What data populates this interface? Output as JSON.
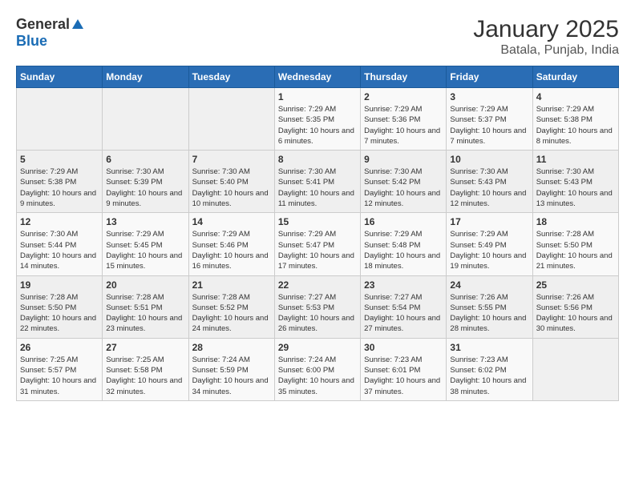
{
  "header": {
    "logo_general": "General",
    "logo_blue": "Blue",
    "title": "January 2025",
    "subtitle": "Batala, Punjab, India"
  },
  "calendar": {
    "weekdays": [
      "Sunday",
      "Monday",
      "Tuesday",
      "Wednesday",
      "Thursday",
      "Friday",
      "Saturday"
    ],
    "weeks": [
      [
        {
          "day": "",
          "sunrise": "",
          "sunset": "",
          "daylight": ""
        },
        {
          "day": "",
          "sunrise": "",
          "sunset": "",
          "daylight": ""
        },
        {
          "day": "",
          "sunrise": "",
          "sunset": "",
          "daylight": ""
        },
        {
          "day": "1",
          "sunrise": "Sunrise: 7:29 AM",
          "sunset": "Sunset: 5:35 PM",
          "daylight": "Daylight: 10 hours and 6 minutes."
        },
        {
          "day": "2",
          "sunrise": "Sunrise: 7:29 AM",
          "sunset": "Sunset: 5:36 PM",
          "daylight": "Daylight: 10 hours and 7 minutes."
        },
        {
          "day": "3",
          "sunrise": "Sunrise: 7:29 AM",
          "sunset": "Sunset: 5:37 PM",
          "daylight": "Daylight: 10 hours and 7 minutes."
        },
        {
          "day": "4",
          "sunrise": "Sunrise: 7:29 AM",
          "sunset": "Sunset: 5:38 PM",
          "daylight": "Daylight: 10 hours and 8 minutes."
        }
      ],
      [
        {
          "day": "5",
          "sunrise": "Sunrise: 7:29 AM",
          "sunset": "Sunset: 5:38 PM",
          "daylight": "Daylight: 10 hours and 9 minutes."
        },
        {
          "day": "6",
          "sunrise": "Sunrise: 7:30 AM",
          "sunset": "Sunset: 5:39 PM",
          "daylight": "Daylight: 10 hours and 9 minutes."
        },
        {
          "day": "7",
          "sunrise": "Sunrise: 7:30 AM",
          "sunset": "Sunset: 5:40 PM",
          "daylight": "Daylight: 10 hours and 10 minutes."
        },
        {
          "day": "8",
          "sunrise": "Sunrise: 7:30 AM",
          "sunset": "Sunset: 5:41 PM",
          "daylight": "Daylight: 10 hours and 11 minutes."
        },
        {
          "day": "9",
          "sunrise": "Sunrise: 7:30 AM",
          "sunset": "Sunset: 5:42 PM",
          "daylight": "Daylight: 10 hours and 12 minutes."
        },
        {
          "day": "10",
          "sunrise": "Sunrise: 7:30 AM",
          "sunset": "Sunset: 5:43 PM",
          "daylight": "Daylight: 10 hours and 12 minutes."
        },
        {
          "day": "11",
          "sunrise": "Sunrise: 7:30 AM",
          "sunset": "Sunset: 5:43 PM",
          "daylight": "Daylight: 10 hours and 13 minutes."
        }
      ],
      [
        {
          "day": "12",
          "sunrise": "Sunrise: 7:30 AM",
          "sunset": "Sunset: 5:44 PM",
          "daylight": "Daylight: 10 hours and 14 minutes."
        },
        {
          "day": "13",
          "sunrise": "Sunrise: 7:29 AM",
          "sunset": "Sunset: 5:45 PM",
          "daylight": "Daylight: 10 hours and 15 minutes."
        },
        {
          "day": "14",
          "sunrise": "Sunrise: 7:29 AM",
          "sunset": "Sunset: 5:46 PM",
          "daylight": "Daylight: 10 hours and 16 minutes."
        },
        {
          "day": "15",
          "sunrise": "Sunrise: 7:29 AM",
          "sunset": "Sunset: 5:47 PM",
          "daylight": "Daylight: 10 hours and 17 minutes."
        },
        {
          "day": "16",
          "sunrise": "Sunrise: 7:29 AM",
          "sunset": "Sunset: 5:48 PM",
          "daylight": "Daylight: 10 hours and 18 minutes."
        },
        {
          "day": "17",
          "sunrise": "Sunrise: 7:29 AM",
          "sunset": "Sunset: 5:49 PM",
          "daylight": "Daylight: 10 hours and 19 minutes."
        },
        {
          "day": "18",
          "sunrise": "Sunrise: 7:28 AM",
          "sunset": "Sunset: 5:50 PM",
          "daylight": "Daylight: 10 hours and 21 minutes."
        }
      ],
      [
        {
          "day": "19",
          "sunrise": "Sunrise: 7:28 AM",
          "sunset": "Sunset: 5:50 PM",
          "daylight": "Daylight: 10 hours and 22 minutes."
        },
        {
          "day": "20",
          "sunrise": "Sunrise: 7:28 AM",
          "sunset": "Sunset: 5:51 PM",
          "daylight": "Daylight: 10 hours and 23 minutes."
        },
        {
          "day": "21",
          "sunrise": "Sunrise: 7:28 AM",
          "sunset": "Sunset: 5:52 PM",
          "daylight": "Daylight: 10 hours and 24 minutes."
        },
        {
          "day": "22",
          "sunrise": "Sunrise: 7:27 AM",
          "sunset": "Sunset: 5:53 PM",
          "daylight": "Daylight: 10 hours and 26 minutes."
        },
        {
          "day": "23",
          "sunrise": "Sunrise: 7:27 AM",
          "sunset": "Sunset: 5:54 PM",
          "daylight": "Daylight: 10 hours and 27 minutes."
        },
        {
          "day": "24",
          "sunrise": "Sunrise: 7:26 AM",
          "sunset": "Sunset: 5:55 PM",
          "daylight": "Daylight: 10 hours and 28 minutes."
        },
        {
          "day": "25",
          "sunrise": "Sunrise: 7:26 AM",
          "sunset": "Sunset: 5:56 PM",
          "daylight": "Daylight: 10 hours and 30 minutes."
        }
      ],
      [
        {
          "day": "26",
          "sunrise": "Sunrise: 7:25 AM",
          "sunset": "Sunset: 5:57 PM",
          "daylight": "Daylight: 10 hours and 31 minutes."
        },
        {
          "day": "27",
          "sunrise": "Sunrise: 7:25 AM",
          "sunset": "Sunset: 5:58 PM",
          "daylight": "Daylight: 10 hours and 32 minutes."
        },
        {
          "day": "28",
          "sunrise": "Sunrise: 7:24 AM",
          "sunset": "Sunset: 5:59 PM",
          "daylight": "Daylight: 10 hours and 34 minutes."
        },
        {
          "day": "29",
          "sunrise": "Sunrise: 7:24 AM",
          "sunset": "Sunset: 6:00 PM",
          "daylight": "Daylight: 10 hours and 35 minutes."
        },
        {
          "day": "30",
          "sunrise": "Sunrise: 7:23 AM",
          "sunset": "Sunset: 6:01 PM",
          "daylight": "Daylight: 10 hours and 37 minutes."
        },
        {
          "day": "31",
          "sunrise": "Sunrise: 7:23 AM",
          "sunset": "Sunset: 6:02 PM",
          "daylight": "Daylight: 10 hours and 38 minutes."
        },
        {
          "day": "",
          "sunrise": "",
          "sunset": "",
          "daylight": ""
        }
      ]
    ]
  }
}
